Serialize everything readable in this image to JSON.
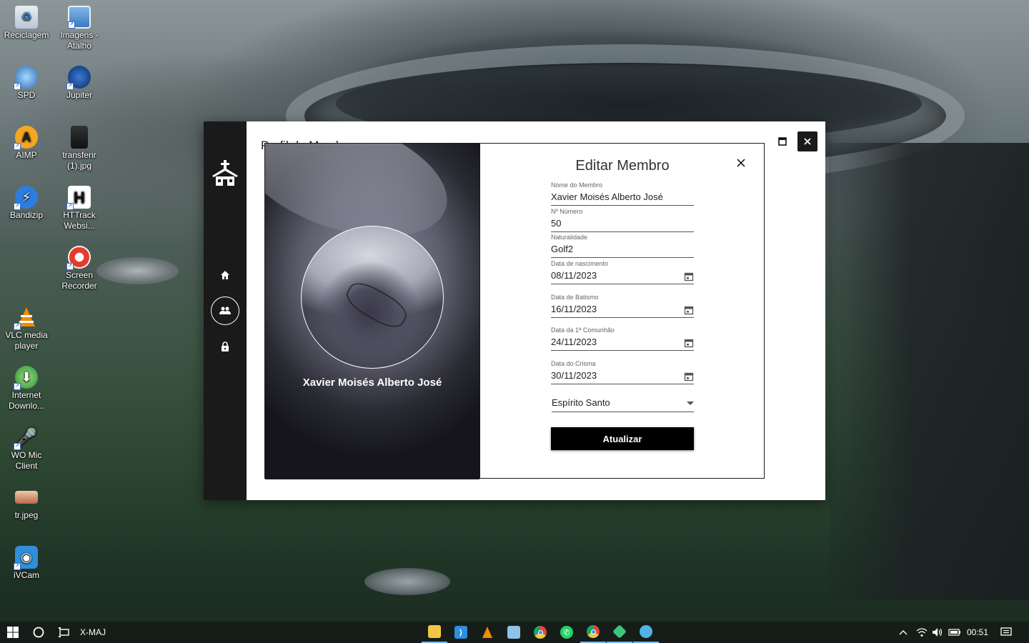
{
  "desktop": {
    "icons": [
      {
        "label": "Reciclagem",
        "icon": "recycle-bin-icon"
      },
      {
        "label": "Imagens - Atalho",
        "icon": "images-shortcut-icon"
      },
      {
        "label": "SPD",
        "icon": "spd-icon"
      },
      {
        "label": "Jupiter",
        "icon": "jupiter-icon"
      },
      {
        "label": "AIMP",
        "icon": "aimp-icon"
      },
      {
        "label": "transferir (1).jpg",
        "icon": "image-file-icon"
      },
      {
        "label": "Bandizip",
        "icon": "bandizip-icon"
      },
      {
        "label": "HTTrack Websi...",
        "icon": "httrack-icon"
      },
      {
        "label": "Screen Recorder",
        "icon": "screen-recorder-icon"
      },
      {
        "label": "VLC media player",
        "icon": "vlc-icon"
      },
      {
        "label": "Internet Downlo...",
        "icon": "internet-download-icon"
      },
      {
        "label": "WO Mic Client",
        "icon": "wo-mic-icon"
      },
      {
        "label": "tr.jpeg",
        "icon": "image-file-icon"
      },
      {
        "label": "iVCam",
        "icon": "ivcam-icon"
      }
    ]
  },
  "window": {
    "title": "Perfil do Membro",
    "sidebar": {
      "logo": "church-icon",
      "nav": [
        {
          "name": "home",
          "icon": "home-icon"
        },
        {
          "name": "members",
          "icon": "people-icon",
          "active": true
        },
        {
          "name": "lock",
          "icon": "lock-icon"
        }
      ]
    }
  },
  "modal": {
    "title": "Editar Membro",
    "profile_name": "Xavier Moisés Alberto José",
    "fields": {
      "nome": {
        "label": "Nome do Membro",
        "value": "Xavier Moisés Alberto José"
      },
      "numero": {
        "label": "Nº Número",
        "value": "50"
      },
      "naturalidade": {
        "label": "Naturalidade",
        "value": "Golf2"
      },
      "nascimento": {
        "label": "Data de nascimento",
        "value": "08/11/2023"
      },
      "batismo": {
        "label": "Data de Batismo",
        "value": "16/11/2023"
      },
      "comunhao": {
        "label": "Data da 1ª Comunhão",
        "value": "24/11/2023"
      },
      "crisma": {
        "label": "Data do Crisma",
        "value": "30/11/2023"
      }
    },
    "select": {
      "value": "Espírito Santo"
    },
    "submit_label": "Atualizar"
  },
  "taskbar": {
    "search_label": "X-MAJ",
    "apps": [
      {
        "name": "file-explorer",
        "icon": "folder-icon",
        "color": "#f4c542",
        "running": true
      },
      {
        "name": "vscode",
        "icon": "vscode-icon",
        "color": "#2b8fe0",
        "running": false
      },
      {
        "name": "vlc",
        "icon": "vlc-icon",
        "color": "#f08a00",
        "running": false
      },
      {
        "name": "notepad",
        "icon": "notepad-icon",
        "color": "#8ec3e8",
        "running": false
      },
      {
        "name": "chrome",
        "icon": "chrome-icon",
        "color": "#dd4b39",
        "running": false
      },
      {
        "name": "whatsapp",
        "icon": "whatsapp-icon",
        "color": "#25d366",
        "running": false
      },
      {
        "name": "chrome-2",
        "icon": "chrome-icon",
        "color": "#dd4b39",
        "running": true
      },
      {
        "name": "git-kraken",
        "icon": "git-icon",
        "color": "#3ec57a",
        "running": true
      },
      {
        "name": "app-running",
        "icon": "app-icon",
        "color": "#4fb3e8",
        "running": true
      }
    ],
    "clock": "00:51"
  }
}
